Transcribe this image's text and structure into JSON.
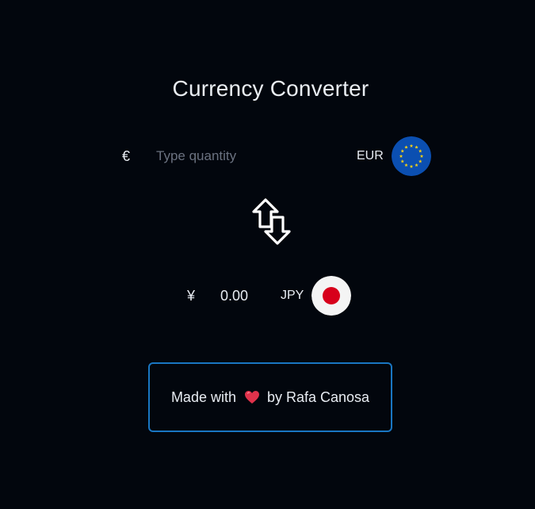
{
  "app": {
    "title": "Currency Converter"
  },
  "from": {
    "symbol": "€",
    "placeholder": "Type quantity",
    "value": "",
    "code": "EUR",
    "flag_icon": "eu-flag-icon"
  },
  "swap": {
    "icon": "swap-arrows-icon"
  },
  "to": {
    "symbol": "¥",
    "value": "0.00",
    "code": "JPY",
    "flag_icon": "japan-flag-icon"
  },
  "footer": {
    "prefix": "Made with",
    "suffix": "by Rafa Canosa",
    "heart_icon": "heart-icon",
    "border_color": "#1976c2"
  },
  "colors": {
    "background": "#02060d",
    "eu_blue": "#0b4fb1",
    "eu_star": "#f7d117",
    "japan_red": "#d7001b",
    "heart": "#e0324b"
  }
}
